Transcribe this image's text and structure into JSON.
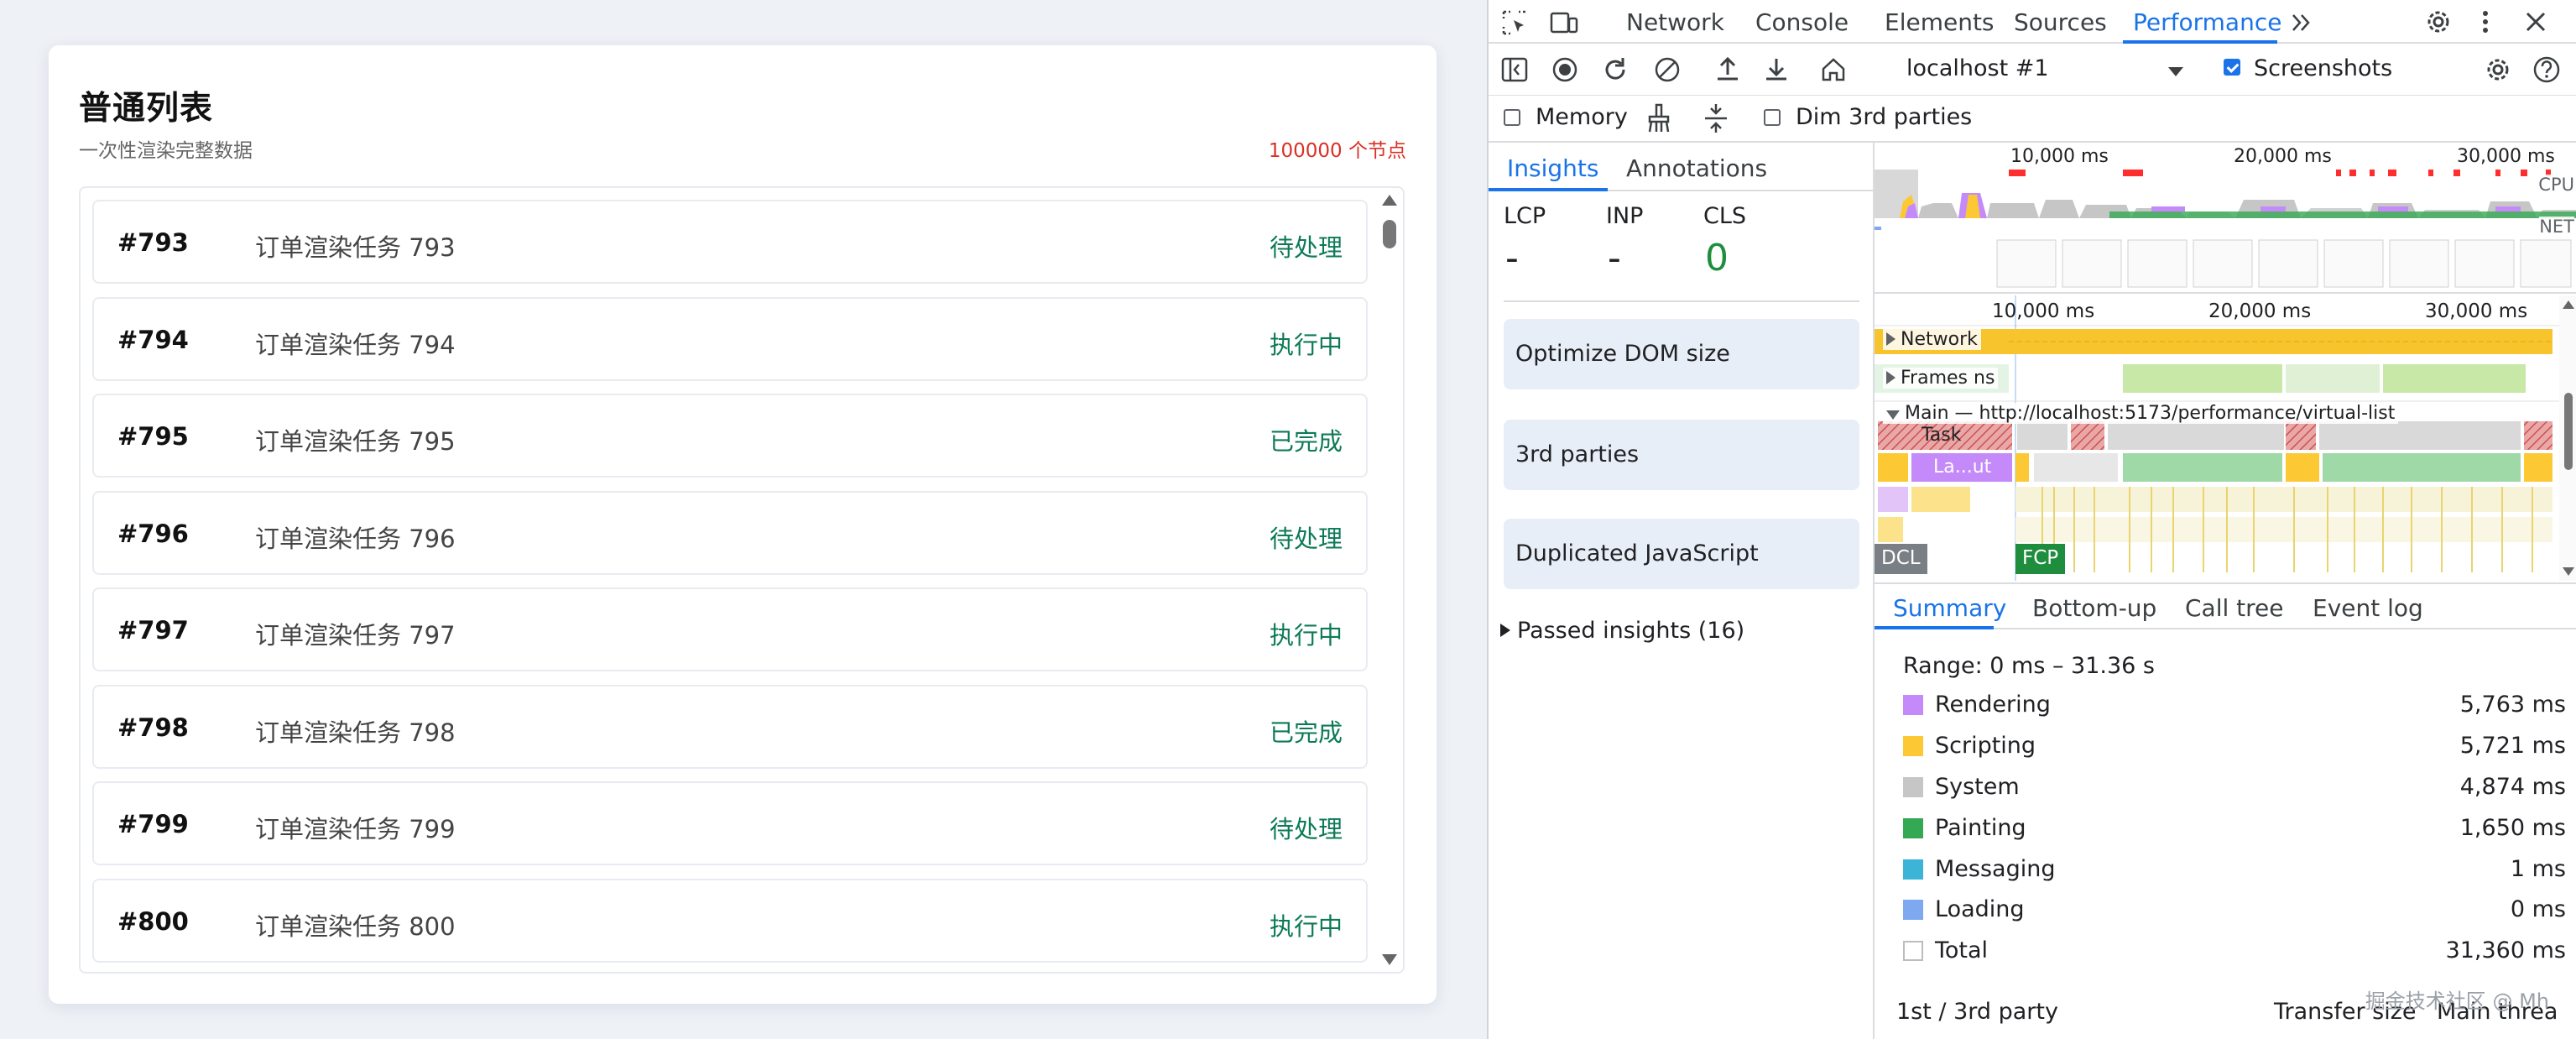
{
  "app": {
    "title": "普通列表",
    "subtitle": "一次性渲染完整数据",
    "node_count": "100000 个节点",
    "items": [
      {
        "id": "#793",
        "name": "订单渲染任务 793",
        "status": "待处理"
      },
      {
        "id": "#794",
        "name": "订单渲染任务 794",
        "status": "执行中"
      },
      {
        "id": "#795",
        "name": "订单渲染任务 795",
        "status": "已完成"
      },
      {
        "id": "#796",
        "name": "订单渲染任务 796",
        "status": "待处理"
      },
      {
        "id": "#797",
        "name": "订单渲染任务 797",
        "status": "执行中"
      },
      {
        "id": "#798",
        "name": "订单渲染任务 798",
        "status": "已完成"
      },
      {
        "id": "#799",
        "name": "订单渲染任务 799",
        "status": "待处理"
      },
      {
        "id": "#800",
        "name": "订单渲染任务 800",
        "status": "执行中"
      }
    ]
  },
  "devtools": {
    "tabs": [
      "Network",
      "Console",
      "Elements",
      "Sources",
      "Performance"
    ],
    "active_tab": "Performance",
    "toolbar": {
      "target": "localhost #1",
      "screenshots_label": "Screenshots",
      "screenshots_checked": true,
      "memory_label": "Memory",
      "memory_checked": false,
      "dim_label": "Dim 3rd parties",
      "dim_checked": false
    },
    "insights": {
      "tabs": [
        "Insights",
        "Annotations"
      ],
      "metrics": [
        {
          "label": "LCP",
          "value": "-"
        },
        {
          "label": "INP",
          "value": "-"
        },
        {
          "label": "CLS",
          "value": "0"
        }
      ],
      "cards": [
        "Optimize DOM size",
        "3rd parties",
        "Duplicated JavaScript"
      ],
      "passed": "Passed insights (16)"
    },
    "timeline": {
      "overview_ticks": [
        "10,000 ms",
        "20,000 ms",
        "30,000 ms"
      ],
      "cpu_label": "CPU",
      "net_label": "NET",
      "ticks": [
        "10,000 ms",
        "20,000 ms",
        "30,000 ms"
      ],
      "tracks": {
        "network": "Network",
        "frames": "Frames",
        "frames_suffix": "ns",
        "main": "Main — http://localhost:5173/performance/virtual-list"
      },
      "task_label": "Task",
      "layout_label": "La...ut",
      "markers": {
        "dcl": "DCL",
        "fcp": "FCP"
      }
    },
    "bottom": {
      "tabs": [
        "Summary",
        "Bottom-up",
        "Call tree",
        "Event log"
      ],
      "range": "Range: 0 ms – 31.36 s",
      "categories": [
        {
          "name": "Rendering",
          "time": "5,763 ms",
          "color": "#c58af9"
        },
        {
          "name": "Scripting",
          "time": "5,721 ms",
          "color": "#fcc934"
        },
        {
          "name": "System",
          "time": "4,874 ms",
          "color": "#c6c6c6"
        },
        {
          "name": "Painting",
          "time": "1,650 ms",
          "color": "#34a853"
        },
        {
          "name": "Messaging",
          "time": "1 ms",
          "color": "#3cb4d8"
        },
        {
          "name": "Loading",
          "time": "0 ms",
          "color": "#7ea8f0"
        },
        {
          "name": "Total",
          "time": "31,360 ms",
          "color": "#ffffff"
        }
      ],
      "party_header": {
        "left": "1st / 3rd party",
        "mid": "Transfer size",
        "right": "Main threa"
      }
    },
    "watermark": "掘金技术社区 @ Mh"
  }
}
